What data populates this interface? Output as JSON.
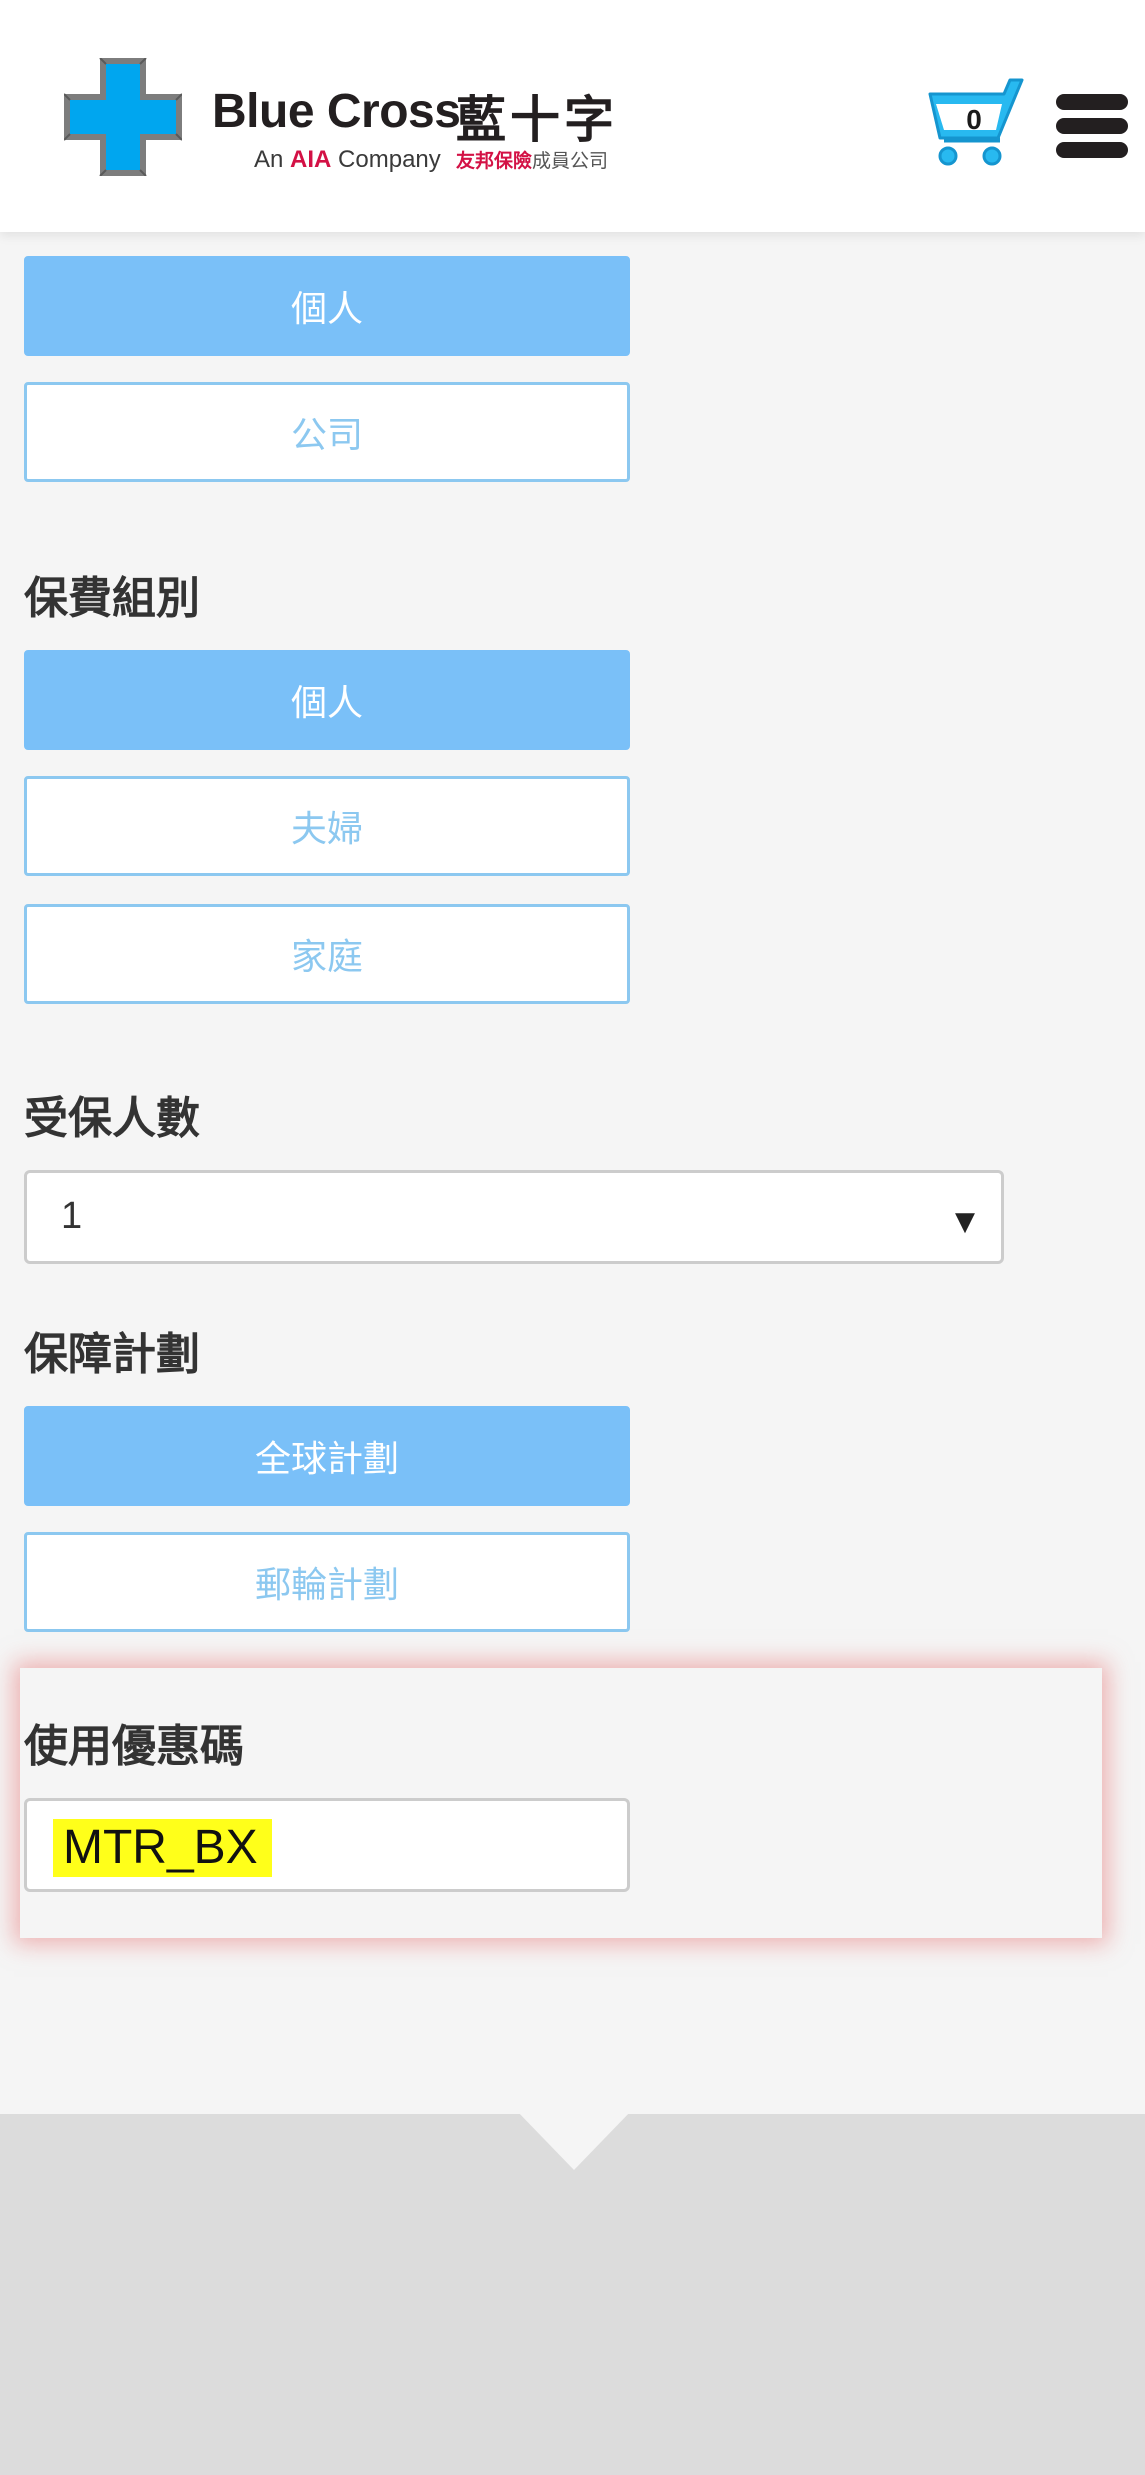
{
  "header": {
    "brand_name_en": "Blue Cross",
    "brand_name_zh": "藍十字",
    "tagline_prefix": "An",
    "tagline_highlight": "AIA",
    "tagline_suffix": "Company",
    "tagline_zh_highlight": "友邦保險",
    "tagline_zh_suffix": "成員公司",
    "cart_count": "0",
    "colors": {
      "cross": "#00a6ef",
      "cart": "#28b9f0",
      "aia_red": "#d31145"
    }
  },
  "applicant_type": {
    "options": [
      {
        "label": "個人",
        "selected": true
      },
      {
        "label": "公司",
        "selected": false
      }
    ]
  },
  "premium_group": {
    "title": "保費組別",
    "options": [
      {
        "label": "個人",
        "selected": true
      },
      {
        "label": "夫婦",
        "selected": false
      },
      {
        "label": "家庭",
        "selected": false
      }
    ]
  },
  "insured_count": {
    "title": "受保人數",
    "value": "1",
    "arrow": "▼"
  },
  "coverage_plan": {
    "title": "保障計劃",
    "options": [
      {
        "label": "全球計劃",
        "selected": true
      },
      {
        "label": "郵輪計劃",
        "selected": false
      }
    ]
  },
  "promo": {
    "title": "使用優惠碼",
    "value": "MTR_BX"
  },
  "colors": {
    "selected_button": "#7ac0f8",
    "unselected_border": "#8cc8f0",
    "page_background": "#f5f5f5",
    "highlight": "#ffff1a"
  }
}
